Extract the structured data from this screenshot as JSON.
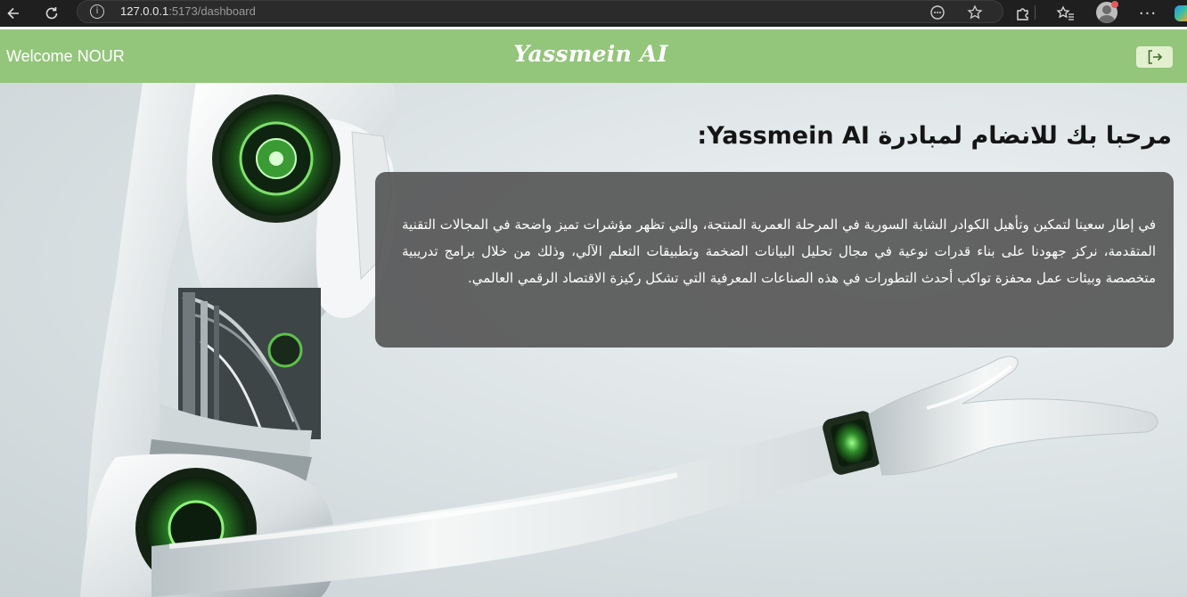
{
  "browser": {
    "url_host": "127.0.0.1",
    "url_rest": ":5173/dashboard",
    "icons": {
      "back": "back-arrow-icon",
      "reload": "reload-icon",
      "site_info": "site-info-icon",
      "reader": "reader-icon",
      "favorite": "star-icon",
      "extensions": "extensions-icon",
      "favorites": "favorites-icon",
      "profile": "avatar",
      "menu": "more-icon"
    }
  },
  "header": {
    "welcome": "Welcome NOUR",
    "brand": "Yassmein AI",
    "logout_icon": "logout-icon",
    "color": "#93c57b"
  },
  "main": {
    "heading": "مرحبا بك للانضام لمبادرة Yassmein AI:",
    "paragraph": "في إطار سعينا لتمكين وتأهيل الكوادر الشابة السورية في المرحلة العمرية المنتجة، والتي تظهر مؤشرات تميز واضحة في المجالات التقنية المتقدمة، نركز جهودنا على بناء قدرات نوعية في مجال تحليل البيانات الضخمة وتطبيقات التعلم الآلي، وذلك من خلال برامج تدريبية متخصصة وبيئات عمل محفزة تواكب أحدث التطورات في هذه الصناعات المعرفية التي تشكل ركيزة الاقتصاد الرقمي العالمي.",
    "background_image": "humanoid robot illustration"
  }
}
